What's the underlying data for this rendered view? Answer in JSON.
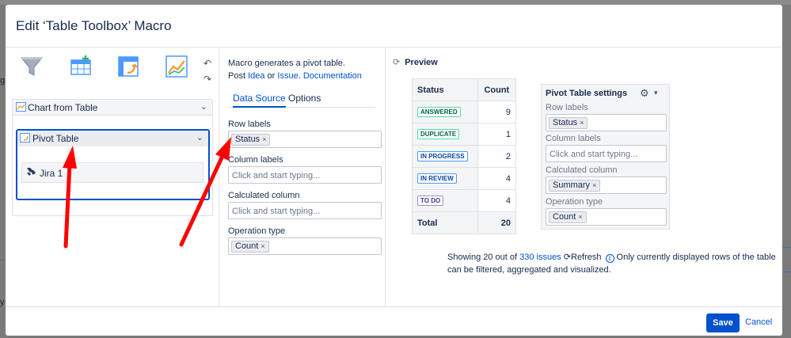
{
  "dialog": {
    "title": "Edit ‘Table Toolbox’ Macro"
  },
  "background": {
    "glyphs": [
      "g",
      "y"
    ]
  },
  "toolbar": {
    "buttons": [
      "filter-icon",
      "table-add-icon",
      "pivot-table-icon",
      "chart-icon"
    ],
    "undo_icon": "undo-icon",
    "redo_icon": "redo-icon"
  },
  "macro_tree": {
    "chart_item": "Chart from Table",
    "pivot_item": "Pivot Table",
    "jira_item": "Jira 1"
  },
  "config": {
    "intro_text": "Macro generates a pivot table.",
    "post_prefix": "Post ",
    "idea_link": "Idea",
    "or_text": " or ",
    "issue_link": "Issue",
    "period": ".",
    "doc_link": "Documentation",
    "tabs": [
      "Data Source",
      "Options"
    ],
    "row_labels": {
      "label": "Row labels",
      "tag": "Status",
      "remove": "×"
    },
    "column_labels": {
      "label": "Column labels",
      "placeholder": "Click and start typing..."
    },
    "calculated_column": {
      "label": "Calculated column",
      "placeholder": "Click and start typing..."
    },
    "operation_type": {
      "label": "Operation type",
      "tag": "Count",
      "remove": "×"
    }
  },
  "preview": {
    "title": "Preview",
    "table": {
      "headers": [
        "Status",
        "Count"
      ],
      "rows": [
        {
          "status": "ANSWERED",
          "count": "9",
          "color": "#006644"
        },
        {
          "status": "DUPLICATE",
          "count": "1",
          "color": "#006644"
        },
        {
          "status": "IN PROGRESS",
          "count": "2",
          "color": "#0747a6"
        },
        {
          "status": "IN REVIEW",
          "count": "4",
          "color": "#0747a6"
        },
        {
          "status": "TO DO",
          "count": "4",
          "color": "#403294"
        }
      ],
      "total_label": "Total",
      "total_value": "20"
    },
    "settings": {
      "title": "Pivot Table settings",
      "row_labels": {
        "label": "Row labels",
        "tag": "Status",
        "remove": "×"
      },
      "column_labels": {
        "label": "Column labels",
        "placeholder": "Click and start typing..."
      },
      "calculated_column": {
        "label": "Calculated column",
        "tag": "Summary",
        "remove": "×"
      },
      "operation_type": {
        "label": "Operation type",
        "tag": "Count",
        "remove": "×"
      }
    },
    "footer": {
      "showing_prefix": "Showing 20 out of ",
      "issues_link": "330 issues",
      "refresh_label": "Refresh",
      "info_text": "Only currently displayed rows of the table can be filtered, aggregated and visualized."
    }
  },
  "buttons": {
    "save": "Save",
    "cancel": "Cancel"
  },
  "colors": {
    "accent": "#0052cc",
    "annotation": "#ff0000"
  }
}
